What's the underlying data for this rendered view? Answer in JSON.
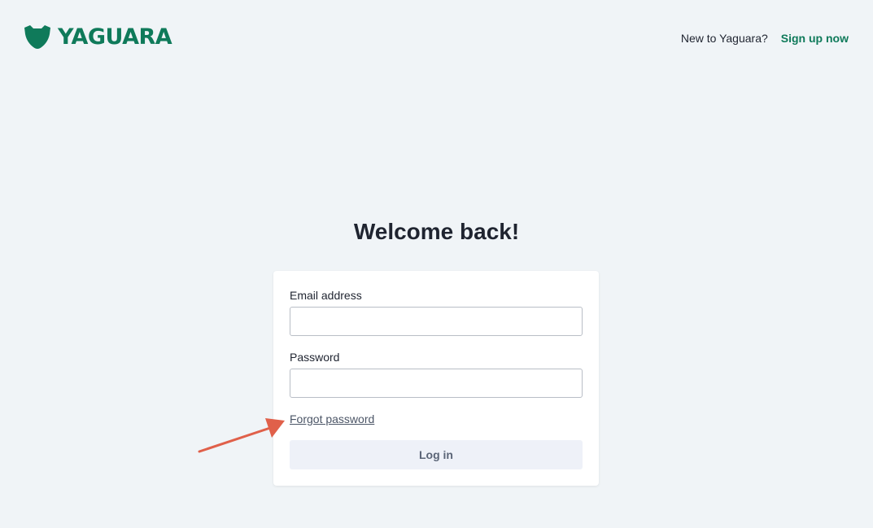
{
  "brand": {
    "name": "YAGUARA",
    "color": "#0f7a5a",
    "icon": "jaguar-head-icon"
  },
  "header": {
    "prompt_text": "New to Yaguara?",
    "signup_label": "Sign up now"
  },
  "main": {
    "title": "Welcome back!"
  },
  "form": {
    "email_label": "Email address",
    "email_value": "",
    "password_label": "Password",
    "password_value": "",
    "forgot_label": "Forgot password",
    "login_label": "Log in"
  },
  "annotation": {
    "icon": "arrow-icon",
    "color": "#e0604a"
  }
}
